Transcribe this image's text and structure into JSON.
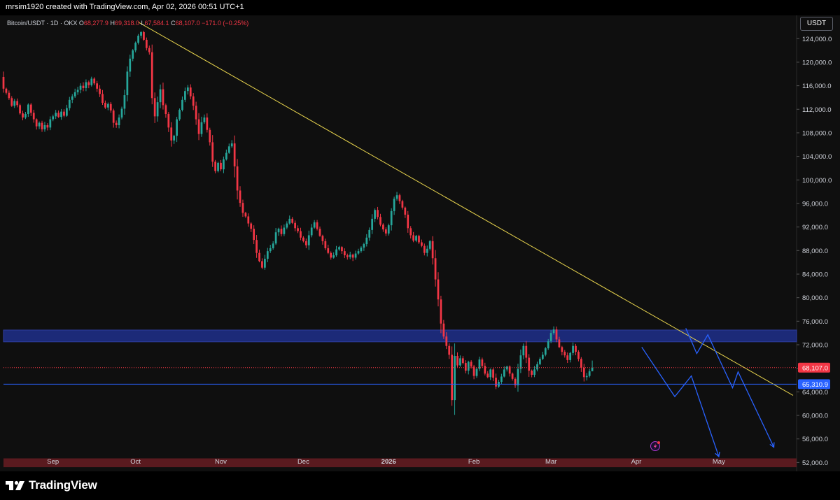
{
  "header": {
    "caption": "mrsim1920 created with TradingView.com, Apr 02, 2026 00:51 UTC+1"
  },
  "legend": {
    "symbol": "Bitcoin/USDT · 1D · OKX",
    "o_label": "O",
    "o_value": "68,277.9",
    "h_label": "H",
    "h_value": "69,318.0",
    "l_label": "L",
    "l_value": "67,584.1",
    "c_label": "C",
    "c_value": "68,107.0",
    "change": "−171.0 (−0.25%)"
  },
  "currency_button": "USDT",
  "footer": {
    "brand": "TradingView"
  },
  "colors": {
    "up": "#26a69a",
    "down": "#f23645",
    "trendline": "#e8d44d",
    "zone_blue": "#1c2a78",
    "zone_red": "#5a1a1f",
    "level_blue": "#2962ff",
    "projection": "#2962ff"
  },
  "chart_data": {
    "type": "candlestick",
    "title": "Bitcoin/USDT · 1D · OKX",
    "y_axis": {
      "ylim": [
        50500,
        127000
      ],
      "ticks": [
        52000,
        56000,
        60000,
        64000,
        68000,
        72000,
        76000,
        80000,
        84000,
        88000,
        92000,
        96000,
        100000,
        104000,
        108000,
        112000,
        116000,
        120000,
        124000
      ],
      "tick_labels": [
        "52,000.0",
        "56,000.0",
        "60,000.0",
        "64,000.0",
        "68,000.0",
        "72,000.0",
        "76,000.0",
        "80,000.0",
        "84,000.0",
        "88,000.0",
        "92,000.0",
        "96,000.0",
        "100,000.0",
        "104,000.0",
        "108,000.0",
        "112,000.0",
        "116,000.0",
        "120,000.0",
        "124,000.0"
      ]
    },
    "x_axis": {
      "start_date": "2025-08-14",
      "end_date": "2026-05-28",
      "ticks": [
        {
          "date": "2025-09-01",
          "label": "Sep",
          "bold": false
        },
        {
          "date": "2025-10-01",
          "label": "Oct",
          "bold": false
        },
        {
          "date": "2025-11-01",
          "label": "Nov",
          "bold": false
        },
        {
          "date": "2025-12-01",
          "label": "Dec",
          "bold": false
        },
        {
          "date": "2026-01-01",
          "label": "2026",
          "bold": true
        },
        {
          "date": "2026-02-01",
          "label": "Feb",
          "bold": false
        },
        {
          "date": "2026-03-01",
          "label": "Mar",
          "bold": false
        },
        {
          "date": "2026-04-01",
          "label": "Apr",
          "bold": false
        },
        {
          "date": "2026-05-01",
          "label": "May",
          "bold": false
        }
      ]
    },
    "candles": {
      "first_date": "2025-08-14",
      "close_prices": [
        115500,
        114800,
        113900,
        112600,
        113400,
        112700,
        111300,
        110600,
        111200,
        112800,
        111400,
        110300,
        109100,
        109700,
        108600,
        109300,
        108900,
        110300,
        110800,
        111400,
        110700,
        111600,
        110900,
        112200,
        113600,
        114200,
        114900,
        115300,
        116000,
        115600,
        116600,
        116100,
        117200,
        116400,
        115500,
        114600,
        113100,
        112300,
        112900,
        111800,
        109700,
        109300,
        110600,
        112100,
        114400,
        118400,
        120600,
        122000,
        123300,
        124500,
        125100,
        123800,
        122400,
        121700,
        113900,
        110800,
        113200,
        115400,
        112700,
        111200,
        108900,
        106700,
        107500,
        110300,
        111900,
        113600,
        115100,
        115700,
        114200,
        112600,
        110300,
        107800,
        109800,
        110600,
        108500,
        106400,
        103100,
        101500,
        102900,
        101800,
        103500,
        104600,
        105700,
        106200,
        102300,
        98200,
        96100,
        94400,
        93800,
        92600,
        91700,
        89800,
        87600,
        86200,
        85100,
        86600,
        87900,
        88400,
        89200,
        91100,
        91700,
        90800,
        91900,
        92600,
        93400,
        92700,
        91800,
        91300,
        90200,
        89600,
        88900,
        90600,
        91900,
        92800,
        91700,
        90500,
        89600,
        88400,
        87600,
        86800,
        87200,
        88200,
        88600,
        87900,
        87200,
        86900,
        87300,
        86800,
        87500,
        87900,
        88500,
        89100,
        90200,
        91500,
        93400,
        94900,
        93700,
        92400,
        91600,
        90900,
        92300,
        94700,
        96800,
        97400,
        96400,
        95300,
        94100,
        91800,
        90600,
        89700,
        90500,
        89400,
        88800,
        87600,
        88300,
        89600,
        86700,
        83100,
        79700,
        75600,
        73400,
        71800,
        70300,
        62600,
        70100,
        68500,
        69700,
        68900,
        67600,
        69100,
        68300,
        66700,
        67900,
        69500,
        68400,
        67100,
        66500,
        67800,
        66400,
        64900,
        65700,
        66600,
        67800,
        68300,
        67100,
        66200,
        65100,
        67900,
        70200,
        71800,
        69800,
        67600,
        66900,
        67800,
        68700,
        69600,
        70300,
        71400,
        72600,
        74000,
        74600,
        72900,
        71600,
        70800,
        70200,
        69400,
        70600,
        71800,
        70800,
        69600,
        68100,
        66500,
        66700,
        67500,
        68107
      ],
      "open_first": 117500
    },
    "annotations": {
      "trendline": {
        "from": {
          "date": "2025-10-02",
          "price": 126800
        },
        "to": {
          "date": "2026-05-28",
          "price": 63400
        }
      },
      "zone_top": {
        "from": 72500,
        "to": 74500
      },
      "zone_bottom": {
        "from": 51200,
        "to": 52700
      },
      "current_price": {
        "price": 68107,
        "label": "68,107.0",
        "color": "#f23645"
      },
      "level": {
        "price": 65310.9,
        "label": "65,310.9",
        "color": "#2962ff"
      },
      "projection_1": [
        {
          "date": "2026-04-03",
          "price": 71600
        },
        {
          "date": "2026-04-15",
          "price": 63200
        },
        {
          "date": "2026-04-21",
          "price": 66700
        },
        {
          "date": "2026-05-01",
          "price": 53000
        }
      ],
      "projection_2": [
        {
          "date": "2026-04-19",
          "price": 74800
        },
        {
          "date": "2026-04-23",
          "price": 70500
        },
        {
          "date": "2026-04-27",
          "price": 73700
        },
        {
          "date": "2026-05-06",
          "price": 64700
        },
        {
          "date": "2026-05-08",
          "price": 67400
        },
        {
          "date": "2026-05-21",
          "price": 54600
        }
      ]
    }
  }
}
